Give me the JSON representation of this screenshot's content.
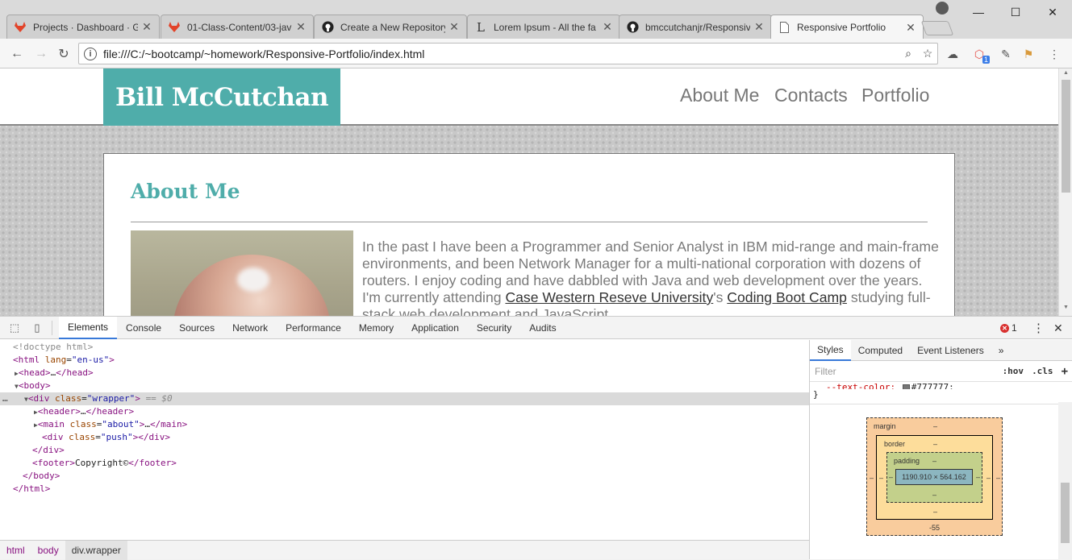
{
  "browser": {
    "tabs": [
      {
        "title": "Projects · Dashboard · G",
        "icon": "gitlab-icon",
        "color": "#e24329"
      },
      {
        "title": "01-Class-Content/03-jav",
        "icon": "gitlab-icon",
        "color": "#e24329"
      },
      {
        "title": "Create a New Repository",
        "icon": "github-icon",
        "color": "#222222"
      },
      {
        "title": "Lorem Ipsum - All the fa",
        "icon": "lorem-icon",
        "color": "#333333"
      },
      {
        "title": "bmccutchanjr/Responsiv",
        "icon": "github-icon",
        "color": "#222222"
      },
      {
        "title": "Responsive Portfolio",
        "icon": "page-icon",
        "color": "#666666"
      }
    ],
    "active_tab_index": 5,
    "url": "file:///C:/~bootcamp/~homework/Responsive-Portfolio/index.html",
    "extension_badge": "1"
  },
  "page": {
    "brand": "Bill McCutchan",
    "nav": [
      "About Me",
      "Contacts",
      "Portfolio"
    ],
    "about_heading": "About Me",
    "bio_before": "In the past I have been a Programmer and Senior Analyst in IBM mid-range and main-frame environments, and been Network Manager for a multi-national corporation with dozens of routers. I enjoy coding and have dabbled with Java and web development over the years. I'm currently attending ",
    "bio_link1": "Case Western Reseve University",
    "bio_between": "'s ",
    "bio_link2": "Coding Boot Camp",
    "bio_after": " studying full-stack web development and JavaScript.",
    "accent": "#4fadaa"
  },
  "devtools": {
    "tabs": [
      "Elements",
      "Console",
      "Sources",
      "Network",
      "Performance",
      "Memory",
      "Application",
      "Security",
      "Audits"
    ],
    "active_tab": "Elements",
    "error_count": "1",
    "dom_lines": {
      "doctype": "<!doctype html>",
      "html_tag": "html",
      "html_attr": "lang",
      "html_val": "\"en-us\"",
      "head": "head",
      "body": "body",
      "div_attr": "class",
      "div_val": "\"wrapper\"",
      "div_marker": "== $0",
      "header": "header",
      "main_val": "\"about\"",
      "push_val": "\"push\"",
      "footer_text": "Copyright©"
    },
    "breadcrumbs": [
      "html",
      "body",
      "div.wrapper"
    ],
    "side_tabs": [
      "Styles",
      "Computed",
      "Event Listeners"
    ],
    "filter_placeholder": "Filter",
    "hov": ":hov",
    "cls": ".cls",
    "css_prop_text": "--text-color:",
    "css_prop_value": "#777777;",
    "box_model": {
      "margin_label": "margin",
      "border_label": "border",
      "padding_label": "padding",
      "content_size": "1190.910 × 564.162",
      "dash": "–",
      "margin_bottom": "-55"
    }
  }
}
